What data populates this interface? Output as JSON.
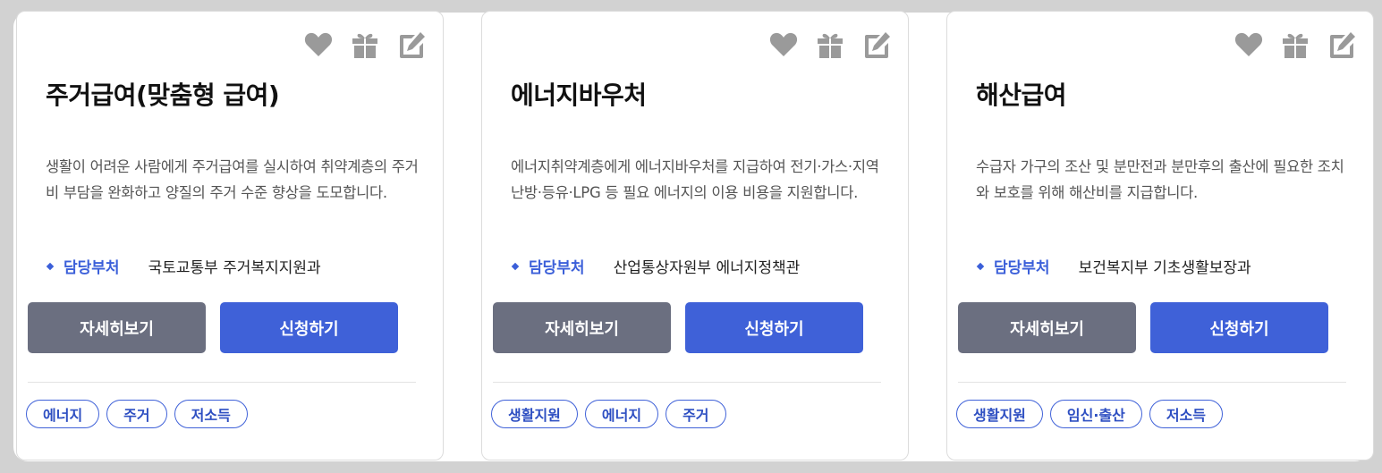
{
  "cards": [
    {
      "title": "주거급여(맞춤형 급여)",
      "description": "생활이 어려운 사람에게 주거급여를 실시하여 취약계층의 주거비 부담을 완화하고 양질의 주거 수준 향상을 도모합니다.",
      "dept_label": "담당부처",
      "dept_value": "국토교통부 주거복지지원과",
      "detail_label": "자세히보기",
      "apply_label": "신청하기",
      "tags": [
        "에너지",
        "주거",
        "저소득"
      ]
    },
    {
      "title": "에너지바우처",
      "description": "에너지취약계층에게 에너지바우처를 지급하여 전기·가스·지역난방·등유·LPG 등 필요 에너지의 이용 비용을 지원합니다.",
      "dept_label": "담당부처",
      "dept_value": "산업통상자원부 에너지정책관",
      "detail_label": "자세히보기",
      "apply_label": "신청하기",
      "tags": [
        "생활지원",
        "에너지",
        "주거"
      ]
    },
    {
      "title": "해산급여",
      "description": "수급자 가구의 조산 및 분만전과 분만후의 출산에 필요한 조치와 보호를 위해 해산비를 지급합니다.",
      "dept_label": "담당부처",
      "dept_value": "보건복지부 기초생활보장과",
      "detail_label": "자세히보기",
      "apply_label": "신청하기",
      "tags": [
        "생활지원",
        "임신·출산",
        "저소득"
      ]
    }
  ],
  "icons": [
    "heart-icon",
    "gift-icon",
    "edit-icon"
  ],
  "colors": {
    "accent": "#3f61d8",
    "detail_button": "#6b6f80",
    "icon_gray": "#9a9a9a",
    "background": "#d2d2d2"
  }
}
